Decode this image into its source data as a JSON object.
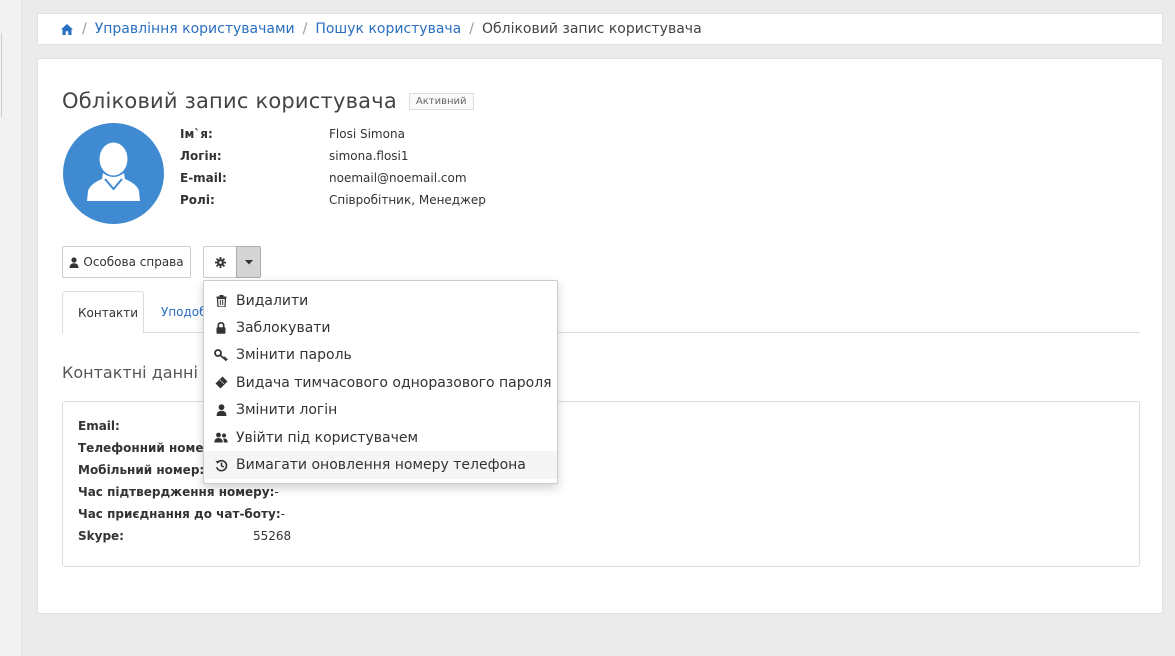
{
  "breadcrumb": {
    "home_icon": "home-icon",
    "items": [
      "Управління користувачами",
      "Пошук користувача"
    ],
    "current": "Обліковий запис користувача"
  },
  "page": {
    "title": "Обліковий запис користувача",
    "status_badge": "Активний",
    "avatar_icon": "user-avatar-icon"
  },
  "user": {
    "rows": [
      {
        "label": "Ім`я:",
        "value": "Flosi Simona"
      },
      {
        "label": "Логін:",
        "value": "simona.flosi1"
      },
      {
        "label": "E-mail:",
        "value": "noemail@noemail.com"
      },
      {
        "label": "Ролі:",
        "value": "Співробітник, Менеджер"
      }
    ]
  },
  "actions": {
    "dossier_label": "Особова справа",
    "dossier_icon": "user-icon",
    "gear_icon": "gear-icon",
    "caret_icon": "caret-down-icon"
  },
  "tabs": [
    {
      "label": "Контакти",
      "active": true
    },
    {
      "label": "Уподоб",
      "active": false
    }
  ],
  "contacts": {
    "title": "Контактні данні",
    "edit_icon": "pencil-icon",
    "rows": [
      {
        "label": "Email:",
        "value": ""
      },
      {
        "label": "Телефонний номер:",
        "value": ""
      },
      {
        "label": "Мобільний номер:",
        "value": ""
      },
      {
        "label": "Час підтвердження номеру:",
        "value": "-"
      },
      {
        "label": "Час приєднання до чат-боту:",
        "value": "-"
      },
      {
        "label": "Skype:",
        "value": "55268"
      }
    ]
  },
  "dropdown": {
    "items": [
      {
        "label": "Видалити",
        "icon": "trash-icon"
      },
      {
        "label": "Заблокувати",
        "icon": "lock-icon"
      },
      {
        "label": "Змінити пароль",
        "icon": "key-icon"
      },
      {
        "label": "Видача тимчасового одноразового пароля",
        "icon": "ticket-icon"
      },
      {
        "label": "Змінити логін",
        "icon": "user-icon"
      },
      {
        "label": "Увійти під користувачем",
        "icon": "users-icon"
      },
      {
        "label": "Вимагати оновлення номеру телефона",
        "icon": "history-icon"
      }
    ],
    "hover_index": 6
  },
  "colors": {
    "link": "#2a6fc2",
    "avatar_bg": "#3f8ad0",
    "page_bg": "#ebebeb"
  }
}
